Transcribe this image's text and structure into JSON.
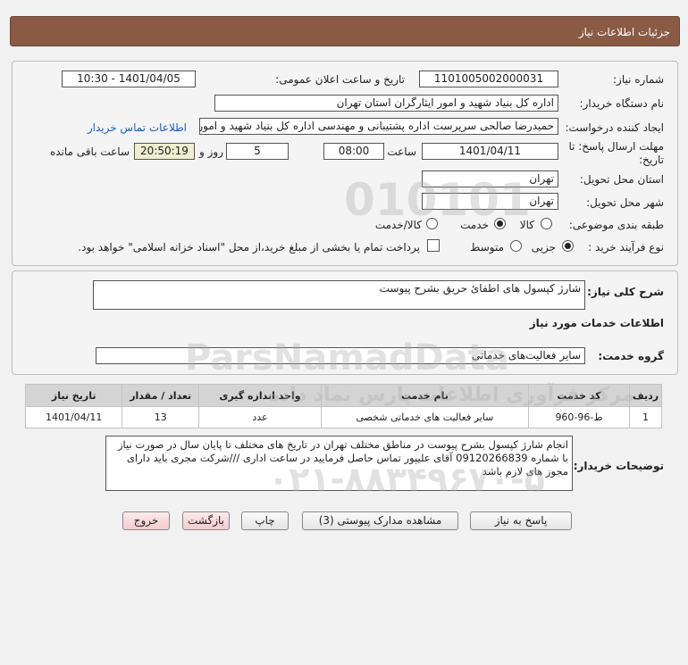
{
  "header": {
    "title": "جزئیات اطلاعات نیاز"
  },
  "form": {
    "need_number_label": "شماره نیاز:",
    "need_number": "1101005002000031",
    "announce_label": "تاریخ و ساعت اعلان عمومی:",
    "announce_value": "1401/04/05 - 10:30",
    "buyer_org_label": "نام دستگاه خریدار:",
    "buyer_org": "اداره کل بنیاد شهید و امور ایثارگران استان تهران",
    "requester_label": "ایجاد کننده درخواست:",
    "requester": "حمیدرضا صالحی سرپرست اداره پشتیبانی و مهندسی اداره کل بنیاد شهید و امور ایثارگران استان تهران",
    "contact_link": "اطلاعات تماس خریدار",
    "deadline_label_1": "مهلت ارسال پاسخ: تا",
    "deadline_label_2": "تاریخ:",
    "deadline_date": "1401/04/11",
    "time_label": "ساعت",
    "deadline_time": "08:00",
    "days_count": "5",
    "days_label": "روز و",
    "remaining_time": "20:50:19",
    "remaining_label": "ساعت باقی مانده",
    "province_label": "استان محل تحویل:",
    "province": "تهران",
    "city_label": "شهر محل تحویل:",
    "city": "تهران",
    "category_label": "طبقه بندی موضوعی:",
    "category_options": [
      "کالا",
      "خدمت",
      "کالا/خدمت"
    ],
    "category_selected": "خدمت",
    "process_label": "نوع فرآیند خرید :",
    "process_options": [
      "جزیی",
      "متوسط"
    ],
    "process_selected": "جزیی",
    "payment_text": "پرداخت تمام یا بخشی از مبلغ خرید،از محل \"اسناد خزانه اسلامی\" خواهد بود."
  },
  "summary": {
    "label": "شرح کلی نیاز:",
    "value": "شارژ کپسول های اطفائ حریق بشرح پیوست"
  },
  "services": {
    "section_title": "اطلاعات خدمات مورد نیاز",
    "group_label": "گروه خدمت:",
    "group_value": "سایر فعالیت‌های خدماتی",
    "columns": [
      "ردیف",
      "کد خدمت",
      "نام خدمت",
      "واحد اندازه گیری",
      "تعداد / مقدار",
      "تاریخ نیاز"
    ],
    "rows": [
      [
        "1",
        "ط-96-960",
        "سایر فعالیت های خدماتی شخصی",
        "عدد",
        "13",
        "1401/04/11"
      ]
    ]
  },
  "buyer_notes": {
    "label": "توضیحات خریدار:",
    "text": "انجام شارژ کپسول بشرح پیوست در مناطق مختلف تهران در تاریخ های مختلف تا پایان سال در صورت نیاز با شماره 09120266839 آقای علیپور تماس حاصل فرمایید در ساعت اداری ///شرکت مجری باید دارای مجوز های لازم باشد"
  },
  "buttons": {
    "reply": "پاسخ به نیاز",
    "attachments": "مشاهده مدارک پیوستی (3)",
    "print": "چاپ",
    "back": "بازگشت",
    "exit": "خروج"
  },
  "watermark": {
    "brand": "ParsNamadData",
    "digits": "010101",
    "persian": "مرکز فرآوری اطلاعات پارس نماد داده",
    "phone": "۰۲۱-۸۸۳۴۹۶۷۰-۵"
  }
}
